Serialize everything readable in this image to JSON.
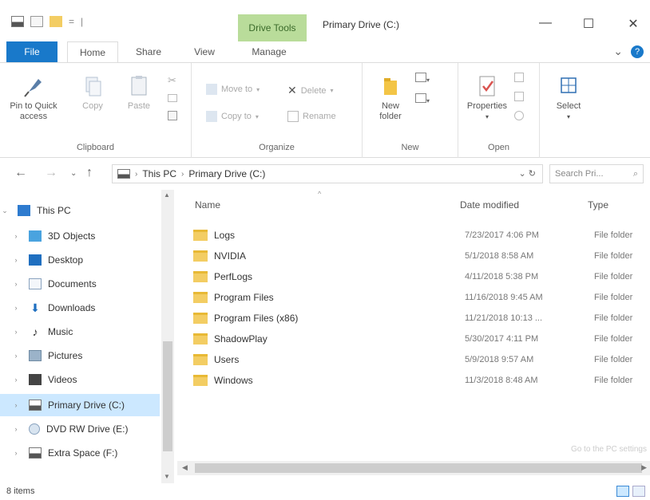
{
  "titlebar": {
    "context_tab": "Drive Tools",
    "title": "Primary Drive (C:)",
    "minimize": "—",
    "maximize": "☐",
    "close": "✕"
  },
  "ribbon_tabs": {
    "file": "File",
    "home": "Home",
    "share": "Share",
    "view": "View",
    "manage": "Manage",
    "help": "?"
  },
  "ribbon": {
    "clipboard": {
      "label": "Clipboard",
      "pin": "Pin to Quick access",
      "copy": "Copy",
      "paste": "Paste"
    },
    "organize": {
      "label": "Organize",
      "move_to": "Move to",
      "copy_to": "Copy to",
      "delete": "Delete",
      "rename": "Rename"
    },
    "new": {
      "label": "New",
      "new_folder": "New folder"
    },
    "open": {
      "label": "Open",
      "properties": "Properties"
    },
    "select": {
      "label": "Select"
    }
  },
  "address": {
    "crumbs": [
      "This PC",
      "Primary Drive (C:)"
    ],
    "search_placeholder": "Search Pri...",
    "search_icon": "search-icon"
  },
  "nav": {
    "items": [
      {
        "label": "This PC",
        "icon": "computer-icon",
        "expanded": true
      },
      {
        "label": "3D Objects",
        "icon": "cube-icon"
      },
      {
        "label": "Desktop",
        "icon": "desktop-icon"
      },
      {
        "label": "Documents",
        "icon": "document-icon"
      },
      {
        "label": "Downloads",
        "icon": "download-icon"
      },
      {
        "label": "Music",
        "icon": "music-icon"
      },
      {
        "label": "Pictures",
        "icon": "picture-icon"
      },
      {
        "label": "Videos",
        "icon": "video-icon"
      },
      {
        "label": "Primary Drive (C:)",
        "icon": "drive-icon",
        "selected": true
      },
      {
        "label": "DVD RW Drive (E:)",
        "icon": "disc-icon"
      },
      {
        "label": "Extra Space (F:)",
        "icon": "drive-icon"
      }
    ]
  },
  "content": {
    "columns": {
      "name": "Name",
      "date": "Date modified",
      "type": "Type"
    },
    "files": [
      {
        "name": "Logs",
        "date": "7/23/2017 4:06 PM",
        "type": "File folder"
      },
      {
        "name": "NVIDIA",
        "date": "5/1/2018 8:58 AM",
        "type": "File folder"
      },
      {
        "name": "PerfLogs",
        "date": "4/11/2018 5:38 PM",
        "type": "File folder"
      },
      {
        "name": "Program Files",
        "date": "11/16/2018 9:45 AM",
        "type": "File folder"
      },
      {
        "name": "Program Files (x86)",
        "date": "11/21/2018 10:13 ...",
        "type": "File folder"
      },
      {
        "name": "ShadowPlay",
        "date": "5/30/2017 4:11 PM",
        "type": "File folder"
      },
      {
        "name": "Users",
        "date": "5/9/2018 9:57 AM",
        "type": "File folder"
      },
      {
        "name": "Windows",
        "date": "11/3/2018 8:48 AM",
        "type": "File folder"
      }
    ],
    "watermark": "Go to the PC settings"
  },
  "status": {
    "items": "8 items"
  }
}
